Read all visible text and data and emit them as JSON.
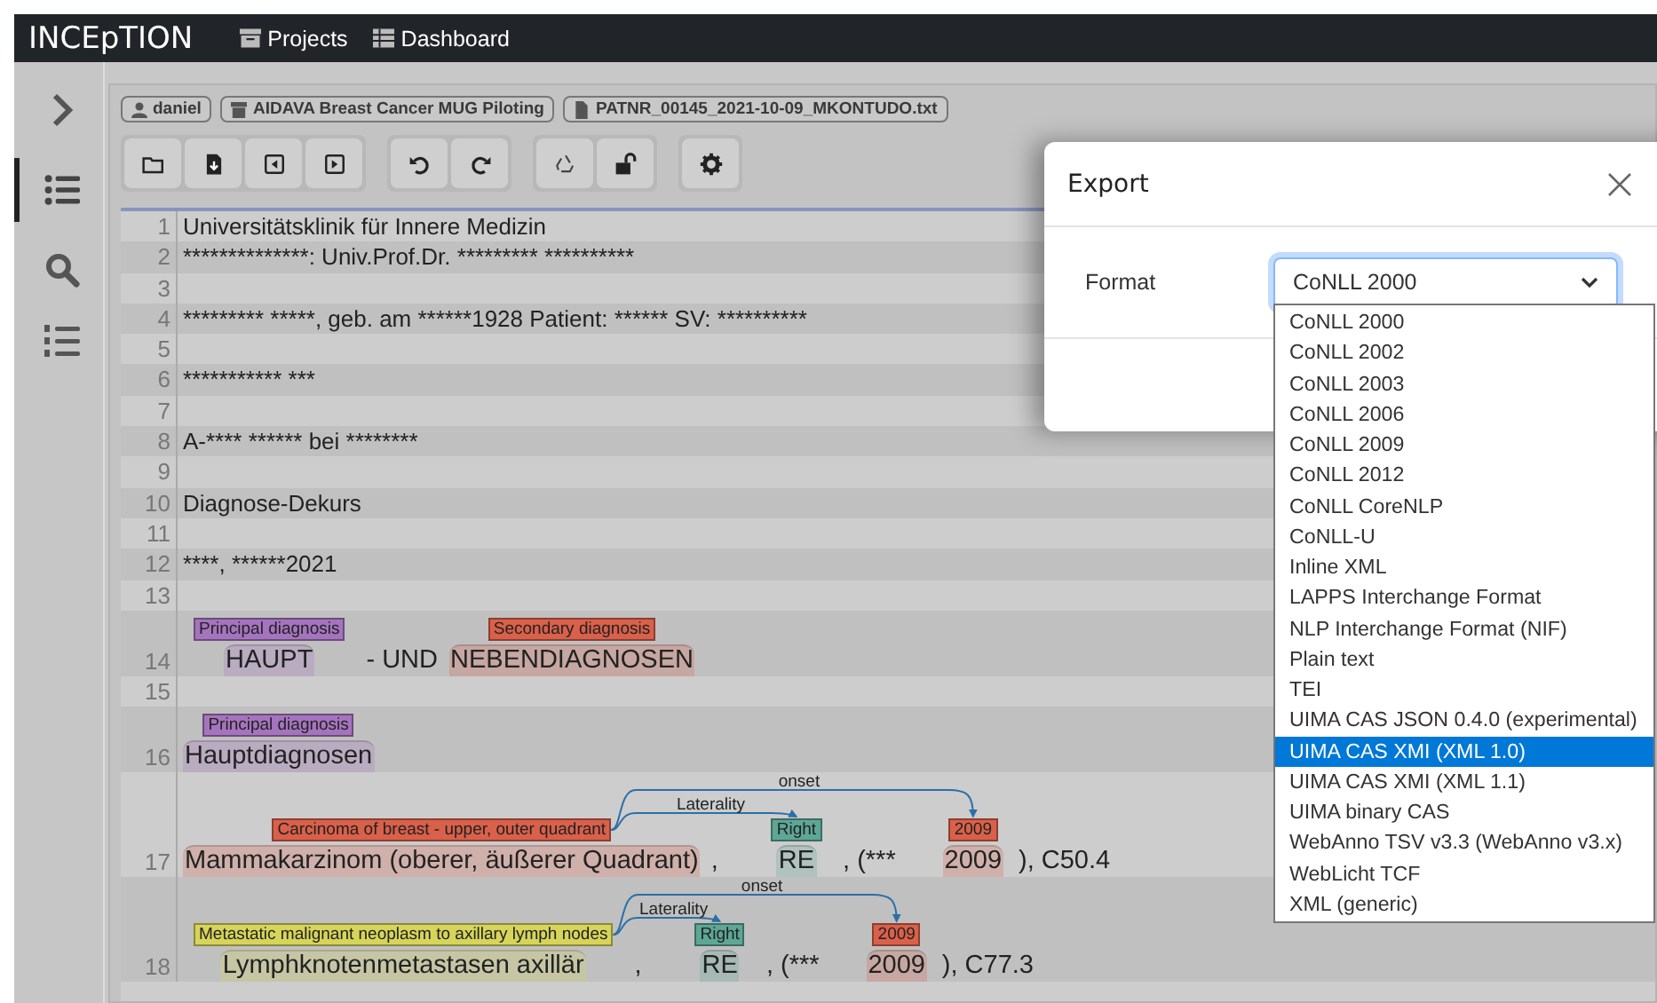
{
  "navbar": {
    "brand": "INCEpTION",
    "links": [
      {
        "kind": "projects",
        "label": "Projects"
      },
      {
        "kind": "dashboard",
        "label": "Dashboard"
      }
    ]
  },
  "sidebar": {
    "items": [
      {
        "kind": "expand",
        "selected": false
      },
      {
        "kind": "list",
        "selected": true
      },
      {
        "kind": "search",
        "selected": false
      },
      {
        "kind": "numbered",
        "selected": false
      }
    ]
  },
  "breadcrumbs": [
    {
      "kind": "user",
      "label": "daniel"
    },
    {
      "kind": "project",
      "label": "AIDAVA Breast Cancer MUG Piloting"
    },
    {
      "kind": "document",
      "label": "PATNR_00145_2021-10-09_MKONTUDO.txt"
    }
  ],
  "editor": {
    "lines": [
      {
        "number": "1",
        "segments": [
          {
            "text": "Universitätsklinik für Innere Medizin"
          }
        ]
      },
      {
        "number": "2",
        "segments": [
          {
            "text": "**************: Univ.Prof.Dr. ********* **********"
          }
        ]
      },
      {
        "number": "3"
      },
      {
        "number": "4",
        "segments": [
          {
            "text": "********* *****, geb. am ******1928 Patient: ****** SV: **********"
          }
        ]
      },
      {
        "number": "5"
      },
      {
        "number": "6",
        "segments": [
          {
            "text": "*********** ***"
          }
        ]
      },
      {
        "number": "7"
      },
      {
        "number": "8",
        "segments": [
          {
            "text": "A-**** ****** bei ********"
          }
        ]
      },
      {
        "number": "9"
      },
      {
        "number": "10",
        "segments": [
          {
            "text": "Diagnose-Dekurs"
          }
        ]
      },
      {
        "number": "11"
      },
      {
        "number": "12",
        "segments": [
          {
            "text": "****, ******2021"
          }
        ]
      },
      {
        "number": "13"
      },
      {
        "number": "14",
        "segments": [
          {
            "text": "HAUPT",
            "label": "Principal diagnosis",
            "color": "#a574be"
          },
          {
            "text": "- UND"
          },
          {
            "text": "NEBENDIAGNOSEN",
            "label": "Secondary diagnosis",
            "color": "#d9604a"
          }
        ]
      },
      {
        "number": "15"
      },
      {
        "number": "16",
        "segments": [
          {
            "text": "Hauptdiagnosen",
            "label": "Principal diagnosis",
            "color": "#a574be"
          }
        ]
      },
      {
        "number": "17",
        "segments": [
          {
            "text": "Mammakarzinom (oberer, äußerer Quadrant)",
            "label": "Carcinoma of breast - upper, outer quadrant",
            "color": "#d9604a"
          },
          {
            "text": ","
          },
          {
            "text": "RE",
            "label": "Right",
            "color": "#5ea696"
          },
          {
            "text": ", (***"
          },
          {
            "text": "2009",
            "label": "2009",
            "color": "#d9604a"
          },
          {
            "text": "), C50.4"
          }
        ],
        "relations": [
          {
            "label": "Laterality"
          },
          {
            "label": "onset"
          }
        ]
      },
      {
        "number": "18",
        "segments": [
          {
            "text": "Lymphknotenmetastasen axillär",
            "label": "Metastatic malignant neoplasm to axillary lymph nodes",
            "color": "#d6d45a"
          },
          {
            "text": ","
          },
          {
            "text": "RE",
            "label": "Right",
            "color": "#5ea696"
          },
          {
            "text": ", (***"
          },
          {
            "text": "2009",
            "label": "2009",
            "color": "#d9604a"
          },
          {
            "text": "), C77.3"
          }
        ],
        "relations": [
          {
            "label": "Laterality"
          },
          {
            "label": "onset"
          }
        ]
      }
    ]
  },
  "export_dialog": {
    "title": "Export",
    "format_label": "Format",
    "format_value": "CoNLL 2000",
    "options": [
      {
        "label": "CoNLL 2000",
        "selected": false
      },
      {
        "label": "CoNLL 2002",
        "selected": false
      },
      {
        "label": "CoNLL 2003",
        "selected": false
      },
      {
        "label": "CoNLL 2006",
        "selected": false
      },
      {
        "label": "CoNLL 2009",
        "selected": false
      },
      {
        "label": "CoNLL 2012",
        "selected": false
      },
      {
        "label": "CoNLL CoreNLP",
        "selected": false
      },
      {
        "label": "CoNLL-U",
        "selected": false
      },
      {
        "label": "Inline XML",
        "selected": false
      },
      {
        "label": "LAPPS Interchange Format",
        "selected": false
      },
      {
        "label": "NLP Interchange Format (NIF)",
        "selected": false
      },
      {
        "label": "Plain text",
        "selected": false
      },
      {
        "label": "TEI",
        "selected": false
      },
      {
        "label": "UIMA CAS JSON 0.4.0 (experimental)",
        "selected": false
      },
      {
        "label": "UIMA CAS XMI (XML 1.0)",
        "selected": true
      },
      {
        "label": "UIMA CAS XMI (XML 1.1)",
        "selected": false
      },
      {
        "label": "UIMA binary CAS",
        "selected": false
      },
      {
        "label": "WebAnno TSV v3.3 (WebAnno v3.x)",
        "selected": false
      },
      {
        "label": "WebLicht TCF",
        "selected": false
      },
      {
        "label": "XML (generic)",
        "selected": false
      }
    ]
  }
}
